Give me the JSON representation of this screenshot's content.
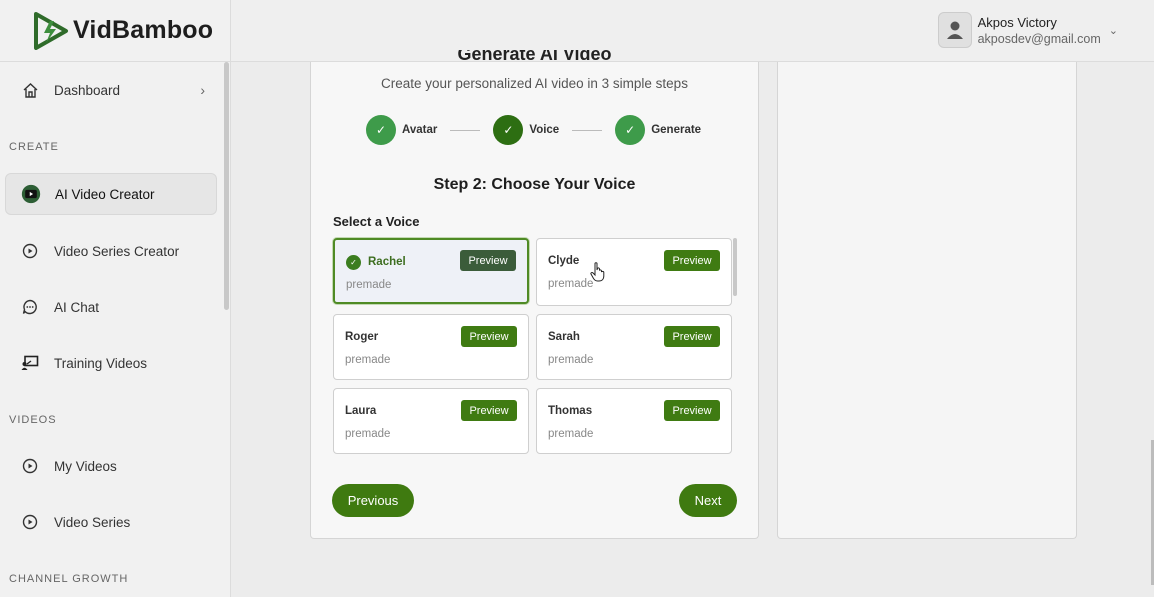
{
  "app": {
    "name": "VidBamboo"
  },
  "sidebar": {
    "items": [
      {
        "label": "Dashboard",
        "icon": "home-icon"
      },
      {
        "label": "AI Video Creator",
        "icon": "youtube-icon",
        "active": true
      },
      {
        "label": "Video Series Creator",
        "icon": "play-circle-icon"
      },
      {
        "label": "AI Chat",
        "icon": "chat-bubble-icon"
      },
      {
        "label": "Training Videos",
        "icon": "presentation-icon"
      },
      {
        "label": "My Videos",
        "icon": "play-circle-icon"
      },
      {
        "label": "Video Series",
        "icon": "play-circle-icon"
      }
    ],
    "sections": {
      "create": "CREATE",
      "videos": "VIDEOS",
      "channel_growth": "CHANNEL GROWTH"
    }
  },
  "user": {
    "name": "Akpos Victory",
    "email": "akposdev@gmail.com"
  },
  "main": {
    "title": "Generate AI Video",
    "subtitle": "Create your personalized AI video in 3 simple steps",
    "steps": [
      {
        "label": "Avatar",
        "done": true
      },
      {
        "label": "Voice",
        "done": true
      },
      {
        "label": "Generate",
        "done": true
      }
    ],
    "step_title": "Step 2: Choose Your Voice",
    "select_label": "Select a Voice",
    "preview_label": "Preview",
    "voices": [
      {
        "name": "Rachel",
        "type": "premade",
        "selected": true
      },
      {
        "name": "Clyde",
        "type": "premade"
      },
      {
        "name": "Roger",
        "type": "premade"
      },
      {
        "name": "Sarah",
        "type": "premade"
      },
      {
        "name": "Laura",
        "type": "premade"
      },
      {
        "name": "Thomas",
        "type": "premade"
      }
    ],
    "previous_label": "Previous",
    "next_label": "Next"
  },
  "colors": {
    "accent": "#3f7a10",
    "step_green": "#3e9b4a",
    "selected_border": "#4f8a25"
  }
}
